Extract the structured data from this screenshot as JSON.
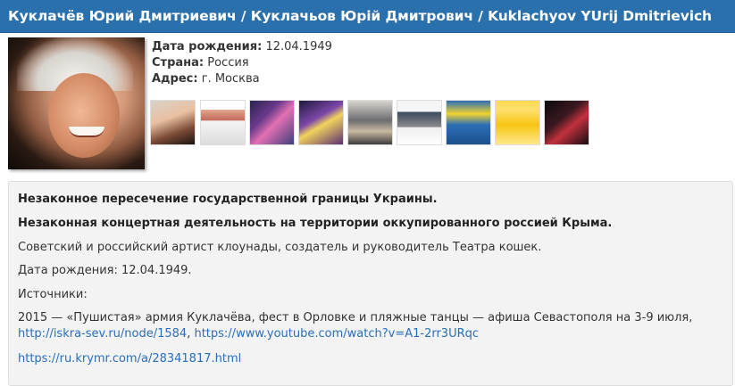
{
  "header": {
    "title": "Куклачёв Юрий Дмитриевич / Куклачьов Юрій Дмитрович / Kuklachyov YUrij Dmitrievich"
  },
  "profile": {
    "birth_label": "Дата рождения:",
    "birth_value": "12.04.1949",
    "country_label": "Страна:",
    "country_value": "Россия",
    "address_label": "Адрес:",
    "address_value": "г. Москва"
  },
  "gallery": {
    "count": 9
  },
  "bio": {
    "warning_1": "Незаконное пересечение государственной границы Украины.",
    "warning_2": "Незаконная концертная деятельность на территории оккупированного россией Крыма.",
    "description": "Советский и российский артист клоунады, создатель и руководитель Театра кошек.",
    "birth": "Дата рождения: 12.04.1949.",
    "sources_label": "Источники:",
    "source_1_text": "2015 —  «Пушистая» армия Куклачёва, фест в Орловке и пляжные танцы — афиша Севастополя на 3-9 июля,",
    "source_1_link_1": "http://iskra-sev.ru/node/1584",
    "source_1_sep": ", ",
    "source_1_link_2": "https://www.youtube.com/watch?v=A1-2rr3URqc",
    "source_2_link": "https://ru.krymr.com/a/28341817.html"
  },
  "colors": {
    "header_bg": "#2a70ad",
    "link": "#2a6ebb",
    "panel_bg": "#f3f3f3"
  }
}
